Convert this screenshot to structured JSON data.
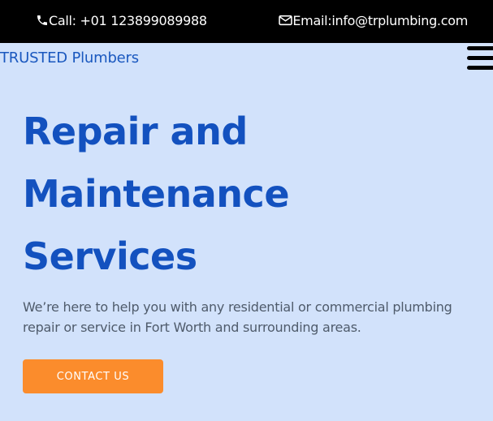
{
  "topbar": {
    "phone_text": "Call: +01 123899089988",
    "phone_icon": "phone-icon",
    "email_text": "Email:info@trplumbing.com",
    "email_icon": "envelope-icon"
  },
  "header": {
    "brand": "TRUSTED Plumbers",
    "menu_icon": "hamburger-menu-icon"
  },
  "hero": {
    "title_lines": [
      "Repair and",
      "Maintenance",
      "Services"
    ],
    "description": "We’re here to help you with any residential or commercial plumbing repair or service in Fort Worth and surrounding areas.",
    "cta_label": "CONTACT US"
  },
  "colors": {
    "page_background": "#d2e2fb",
    "topbar_background": "#000000",
    "accent_blue": "#1351bf",
    "cta_orange": "#fb8c2c"
  }
}
